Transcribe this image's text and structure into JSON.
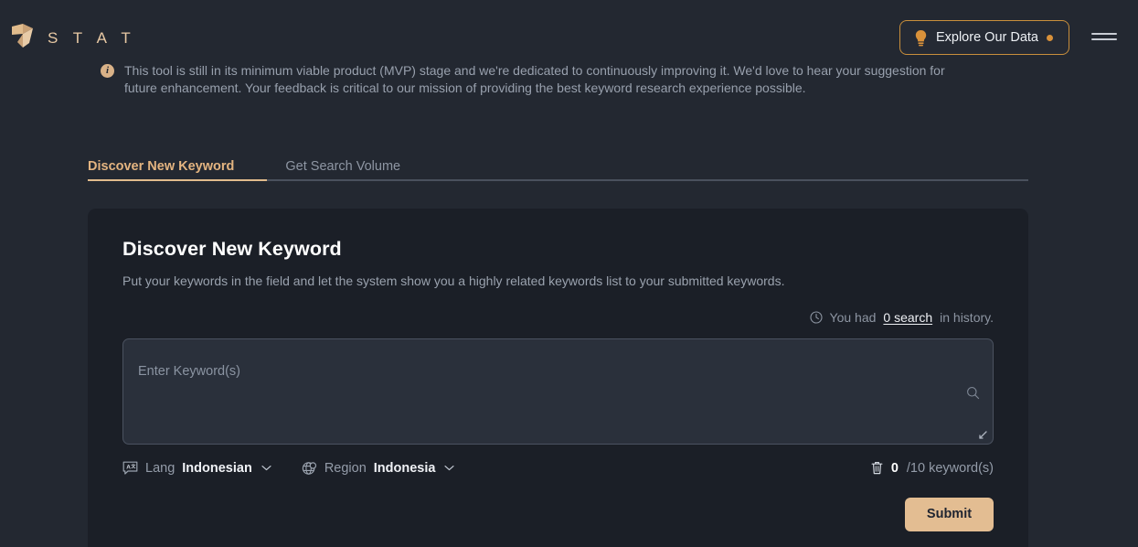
{
  "header": {
    "brand_name": "S T A T",
    "logo_icon": "stat-logo-mark",
    "explore_button": {
      "label": "Explore Our Data",
      "icon": "lightbulb-icon",
      "has_dot": true,
      "border_color": "#c98f3c",
      "dot_color": "#d9913a"
    },
    "menu_icon": "hamburger-menu-icon"
  },
  "banner": {
    "icon": "info-icon",
    "text": "This tool is still in its minimum viable product (MVP) stage and we're dedicated to continuously improving it. We'd love to hear your suggestion for future enhancement. Your feedback is critical to our mission of providing the best keyword research experience possible."
  },
  "tabs": [
    {
      "label": "Discover New Keyword",
      "active": true
    },
    {
      "label": "Get Search Volume",
      "active": false
    }
  ],
  "card": {
    "title": "Discover New Keyword",
    "subtitle": "Put your keywords in the field and let the system show you a highly related keywords list to your submitted keywords.",
    "history": {
      "icon": "clock-icon",
      "prefix": "You had",
      "link": "0 search",
      "suffix": "in history."
    },
    "keyword_input": {
      "placeholder": "Enter Keyword(s)",
      "value": "",
      "search_icon": "search-icon",
      "resize_icon": "resize-grip-icon"
    },
    "language_selector": {
      "icon": "translate-icon",
      "label": "Lang",
      "value": "Indonesian",
      "chevron": "chevron-down-icon"
    },
    "region_selector": {
      "icon": "globe-icon",
      "label": "Region",
      "value": "Indonesia",
      "chevron": "chevron-down-icon"
    },
    "counter": {
      "icon": "trash-icon",
      "current": "0",
      "suffix": "/10 keyword(s)"
    },
    "submit_label": "Submit"
  },
  "colors": {
    "page_background": "#232831",
    "card_background": "#1b1f27",
    "accent_tan": "#e3bd92",
    "accent_orange": "#d9913a",
    "muted_text": "#98a0ad"
  }
}
